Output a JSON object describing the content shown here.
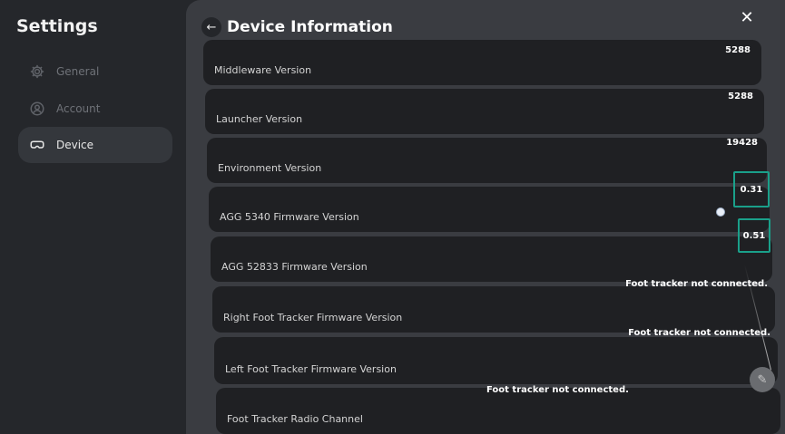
{
  "sidebar": {
    "title": "Settings",
    "items": [
      {
        "label": "General",
        "icon": "gear-icon"
      },
      {
        "label": "Account",
        "icon": "user-circle-icon"
      },
      {
        "label": "Device",
        "icon": "headset-icon",
        "active": true
      }
    ]
  },
  "header": {
    "title": "Device Information"
  },
  "rows": [
    {
      "label": "Middleware Version",
      "value": "5288"
    },
    {
      "label": "Launcher Version",
      "value": "5288"
    },
    {
      "label": "Environment Version",
      "value": "19428"
    },
    {
      "label": "AGG 5340 Firmware Version",
      "value": "0.31"
    },
    {
      "label": "AGG 52833 Firmware Version",
      "value": "0.51"
    },
    {
      "label": "Right Foot Tracker Firmware Version",
      "value": "Foot tracker not connected."
    },
    {
      "label": "Left Foot Tracker Firmware Version",
      "value": "Foot tracker not connected."
    },
    {
      "label": "Foot Tracker Radio Channel",
      "value": "Foot tracker not connected."
    }
  ],
  "colors": {
    "highlight_box": "#1aa08a",
    "row_bg": "#1f2023",
    "panel_bg": "#3a3c41",
    "sidebar_bg": "#25272b"
  }
}
